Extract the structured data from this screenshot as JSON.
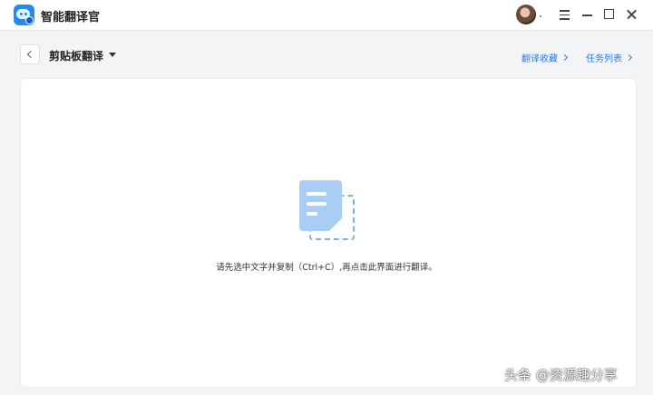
{
  "app": {
    "title": "智能翻译官"
  },
  "header": {
    "page_title": "剪贴板翻译",
    "links": [
      {
        "label": "翻译收藏"
      },
      {
        "label": "任务列表"
      }
    ]
  },
  "main": {
    "hint": "请先选中文字并复制（Ctrl+C）,再点击此界面进行翻译。"
  },
  "watermark": "头条 @资源趣分享",
  "icons": {
    "logo": "translator-robot-icon",
    "menu": "hamburger-icon",
    "minimize": "minimize-icon",
    "maximize": "maximize-icon",
    "close": "close-icon",
    "back": "chevron-left-icon",
    "dropdown": "caret-down-icon",
    "placeholder": "document-clipboard-icon"
  },
  "colors": {
    "accent": "#2a7ae2",
    "logo": "#1f8cf5",
    "doc_icon": "#a9cdf5"
  }
}
